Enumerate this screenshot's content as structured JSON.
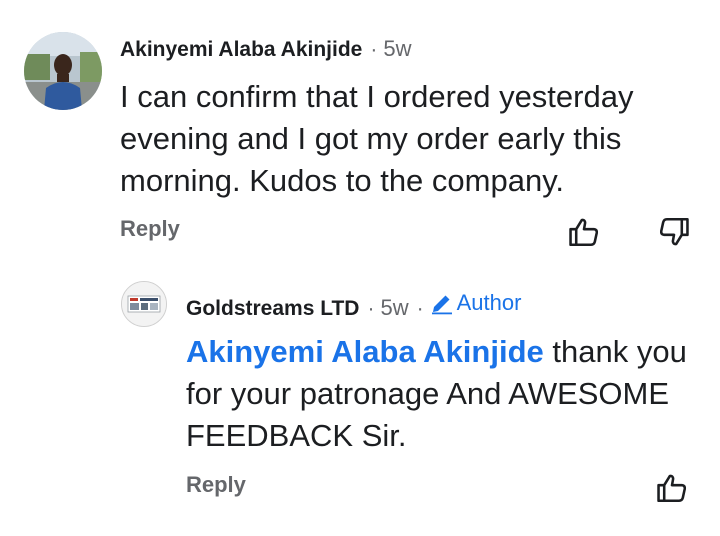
{
  "comment": {
    "author": "Akinyemi Alaba Akinjide",
    "separator": "·",
    "time": "5w",
    "text": "I can confirm that I ordered yesterday evening and I got my order early this morning. Kudos to the company.",
    "reply_label": "Reply",
    "like_icon": "thumbs-up-icon",
    "dislike_icon": "thumbs-down-icon"
  },
  "reply": {
    "author": "Goldstreams LTD",
    "separator": "·",
    "time": "5w",
    "separator2": "·",
    "badge_label": "Author",
    "badge_icon": "pencil-icon",
    "mention": "Akinyemi Alaba Akinjide",
    "text": " thank you for your patronage And AWESOME FEEDBACK Sir.",
    "reply_label": "Reply",
    "like_icon": "thumbs-up-icon"
  },
  "colors": {
    "link_blue": "#1a73e8",
    "secondary_text": "#65676b",
    "primary_text": "#1c1e21"
  }
}
